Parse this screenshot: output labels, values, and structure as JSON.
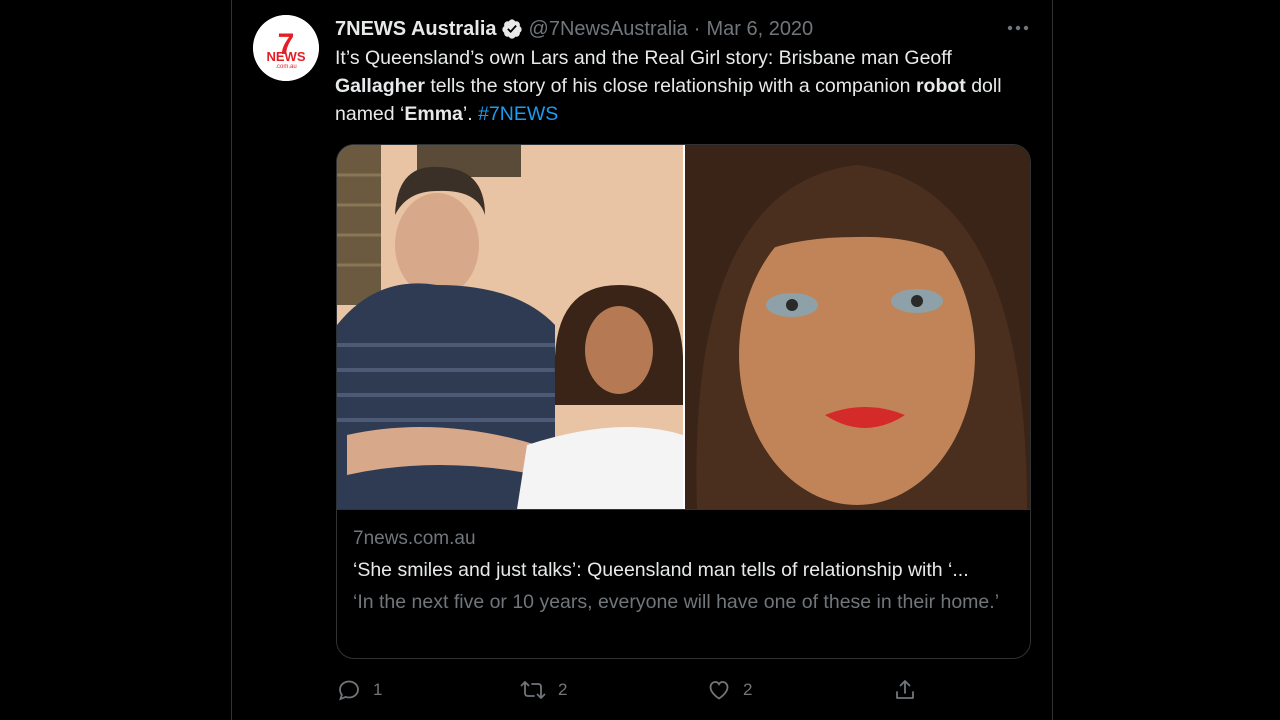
{
  "tweet": {
    "display_name": "7NEWS Australia",
    "handle": "@7NewsAustralia",
    "separator": "·",
    "date": "Mar 6, 2020",
    "avatar": {
      "logo_number": "7",
      "logo_word": "NEWS",
      "logo_domain": ".com.au",
      "brand_color": "#e31e24"
    },
    "verified_icon": "verified-badge-icon",
    "more_icon": "more-horizontal-icon",
    "text": {
      "part1": "It’s Queensland’s own Lars and the Real Girl story: Brisbane man Geoff ",
      "bold1": "Gallagher",
      "part2": " tells the story of his close relationship with a companion ",
      "bold2": "robot",
      "part3": " doll named ‘",
      "bold3": "Emma",
      "part4": "’. ",
      "hashtag": "#7NEWS"
    },
    "hashtag_color": "#1d9bf0"
  },
  "card": {
    "domain": "7news.com.au",
    "title": "‘She smiles and just talks’: Queensland man tells of relationship with ‘...",
    "description": "‘In the next five or 10 years, everyone will have one of these in their home.’"
  },
  "actions": {
    "reply": {
      "icon": "reply-icon",
      "count": "1"
    },
    "retweet": {
      "icon": "retweet-icon",
      "count": "2"
    },
    "like": {
      "icon": "heart-icon",
      "count": "2"
    },
    "share": {
      "icon": "share-icon"
    }
  }
}
